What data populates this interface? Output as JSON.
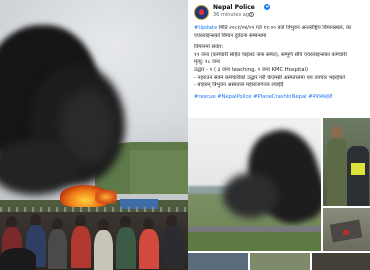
{
  "post": {
    "page_name": "Nepal Police",
    "time_ago": "36 minutes ago",
    "lines": [
      "#Update मिति २०८१/०४/०९ गते ११:०० बजे  त्रिभुवन अन्तर्राष्ट्रिय विमानस्थल, का",
      "एयरलाइन्सको विमान दुर्घटना सम्बन्धमा",
      "",
      "विमानमा सवार:",
      "१९ जना (कर्मचारी सहित पाइलट जना समेत), सम्पूर्ण सौर्य एयरलाइन्सका कर्मचारी",
      "मृत्यु: १८ जना",
      "उद्धार - १ ( ३ जना teaching, १ जना KMC Hospital)",
      "- नहराउन सक्ने कर्मचारीको उद्धार गरी केएमसी अस्पतालमा थप उपचार भइरहेको",
      "- बाहरुन् त्रिभुवन अस्पताल महाराजगञ्ज ल्याईदै"
    ],
    "hashtags": "#rescue #NepalPolice #PlaneCrashInNepal #नेपालप्रहरी"
  },
  "colors": {
    "accent": "#1877f2",
    "text": "#1c1e21",
    "muted": "#65676b"
  }
}
